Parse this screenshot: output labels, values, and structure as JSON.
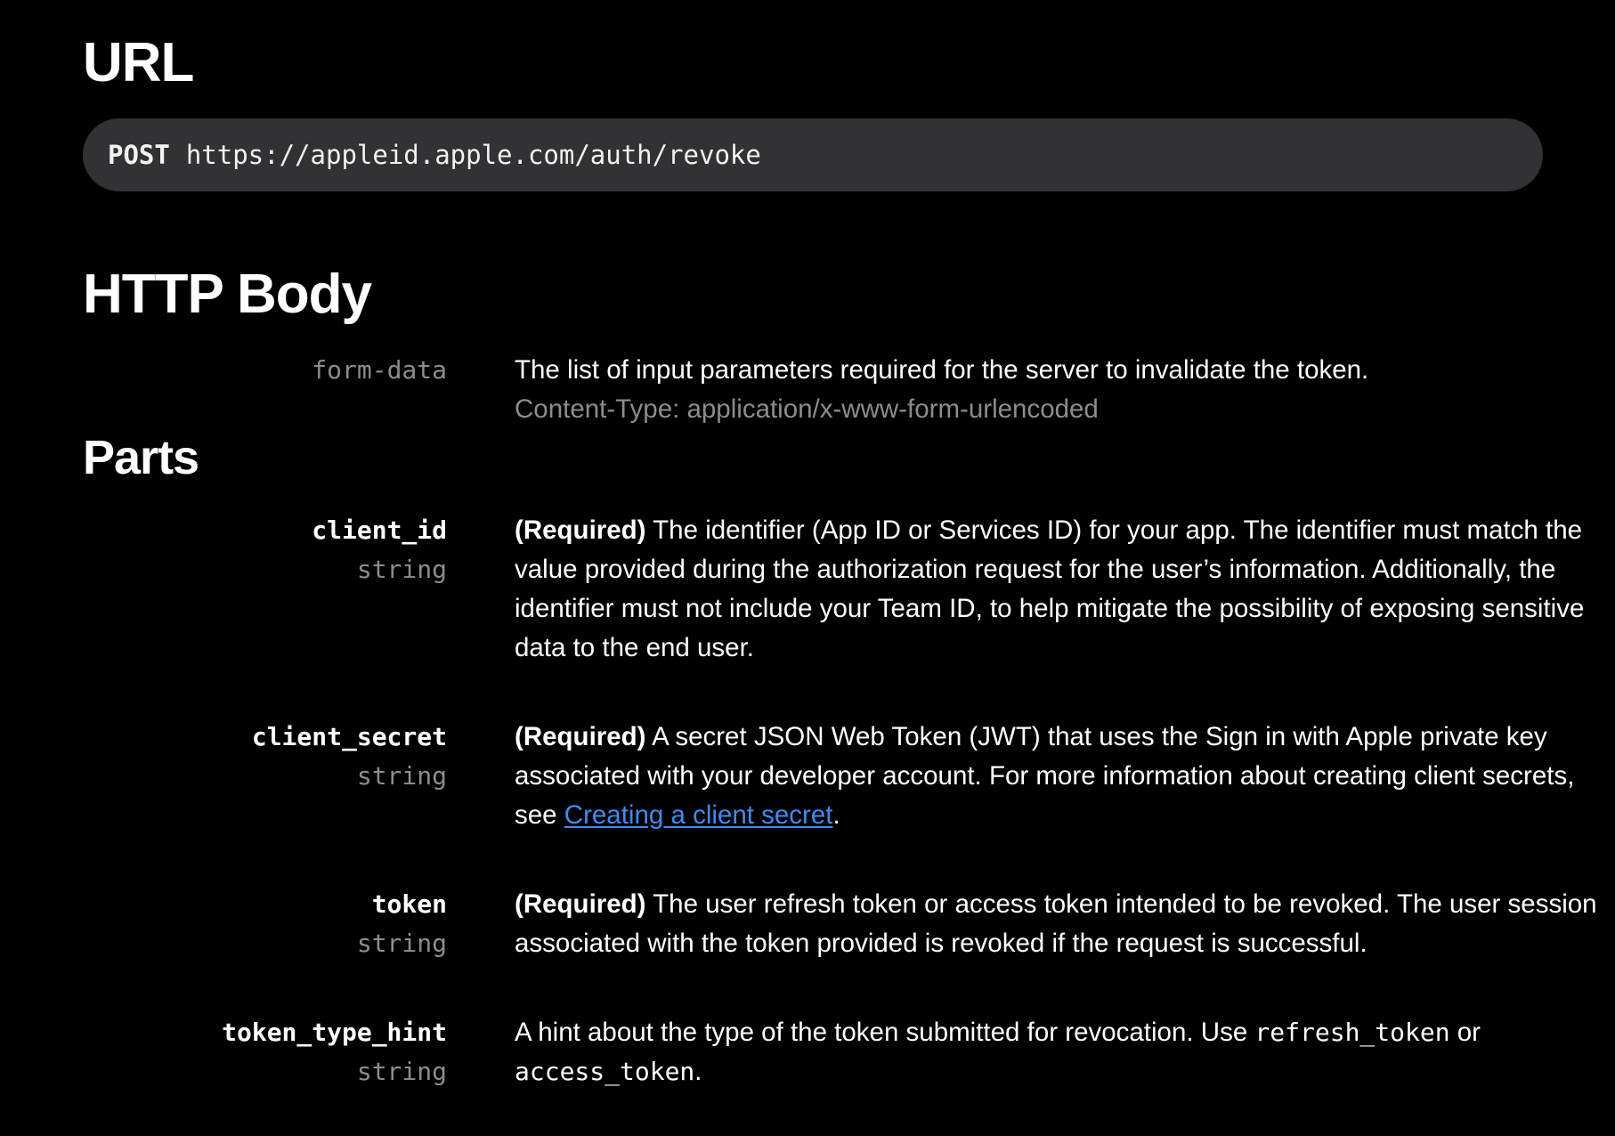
{
  "sections": {
    "url_title": "URL",
    "http_body_title": "HTTP Body",
    "parts_title": "Parts"
  },
  "endpoint": {
    "method": "POST",
    "url": "https://appleid.apple.com/auth/revoke"
  },
  "http_body": {
    "type": "form-data",
    "description": "The list of input parameters required for the server to invalidate the token.",
    "content_type": "Content-Type: application/x-www-form-urlencoded"
  },
  "parts": [
    {
      "name": "client_id",
      "type": "string",
      "required": "(Required)",
      "description": " The identifier (App ID or Services ID) for your app. The identifier must match the value provided during the authorization request for the user’s information. Additionally, the identifier must not include your Team ID, to help mitigate the possibility of exposing sensitive data to the end user."
    },
    {
      "name": "client_secret",
      "type": "string",
      "required": "(Required)",
      "description": " A secret JSON Web Token (JWT) that uses the Sign in with Apple private key associated with your developer account. For more information about creating client secrets, see ",
      "link_text": "Creating a client secret",
      "after_link": "."
    },
    {
      "name": "token",
      "type": "string",
      "required": "(Required)",
      "description": " The user refresh token or access token intended to be revoked. The user session associated with the token provided is revoked if the request is successful."
    },
    {
      "name": "token_type_hint",
      "type": "string",
      "description": "A hint about the type of the token submitted for revocation. Use ",
      "code1": "refresh_token",
      "mid": " or ",
      "code2": "access_token",
      "after": "."
    }
  ],
  "colors": {
    "background": "#000000",
    "endpoint_bg": "#323234",
    "muted_text": "#8c8c8c",
    "link": "#3f8cf0"
  }
}
